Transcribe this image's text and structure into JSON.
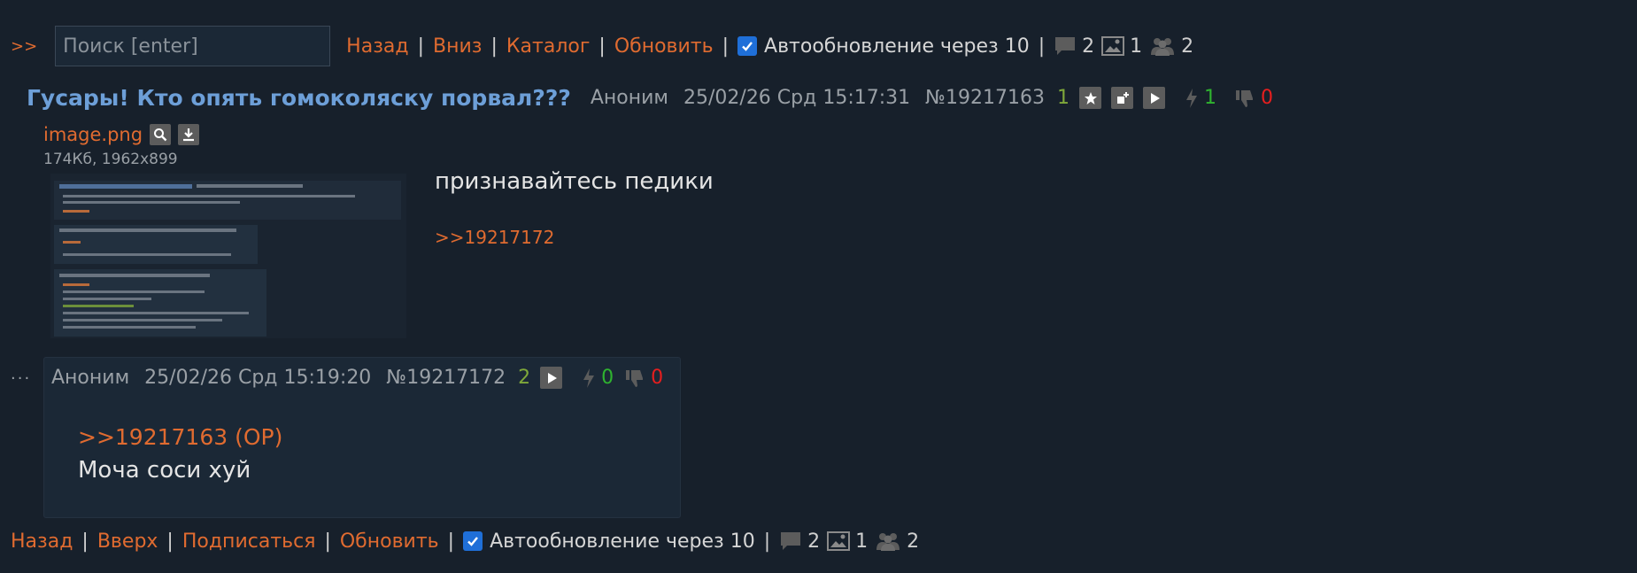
{
  "nav_top": {
    "arrows": ">>",
    "search_placeholder": "Поиск [enter]",
    "links": [
      "Назад",
      "Вниз",
      "Каталог",
      "Обновить"
    ],
    "autoupdate_label": "Автообновление через 10",
    "stats": {
      "posts": "2",
      "images": "1",
      "users": "2"
    }
  },
  "op": {
    "subject": "Гусары! Кто опять гомоколяску порвал???",
    "name": "Аноним",
    "date": "25/02/26 Срд 15:17:31",
    "number": "№19217163",
    "replies": "1",
    "likes": "1",
    "dislikes": "0",
    "file_name": "image.png",
    "file_size": "174Кб, 1962x899",
    "text": "признавайтесь педики",
    "reply_link": ">>19217172"
  },
  "reply": {
    "dots": "...",
    "name": "Аноним",
    "date": "25/02/26 Срд 15:19:20",
    "number": "№19217172",
    "replies": "2",
    "likes": "0",
    "dislikes": "0",
    "quote": ">>19217163 (OP)",
    "text": "Моча соси хуй"
  },
  "nav_bottom": {
    "links": [
      "Назад",
      "Вверх",
      "Подписаться",
      "Обновить"
    ],
    "autoupdate_label": "Автообновление через 10",
    "stats": {
      "posts": "2",
      "images": "1",
      "users": "2"
    }
  },
  "colors": {
    "background": "#17202b",
    "link": "#e06b30",
    "subject": "#6d9fd8",
    "replies": "#7fa83a",
    "like": "#2fb32f",
    "dislike": "#e61e1e",
    "checkbox": "#1f6fd8"
  },
  "icons": [
    "comment-icon",
    "image-icon",
    "users-icon",
    "star-icon",
    "add-icon",
    "play-icon",
    "lightning-icon",
    "thumbs-down-icon",
    "search-icon",
    "download-icon",
    "check-icon"
  ]
}
